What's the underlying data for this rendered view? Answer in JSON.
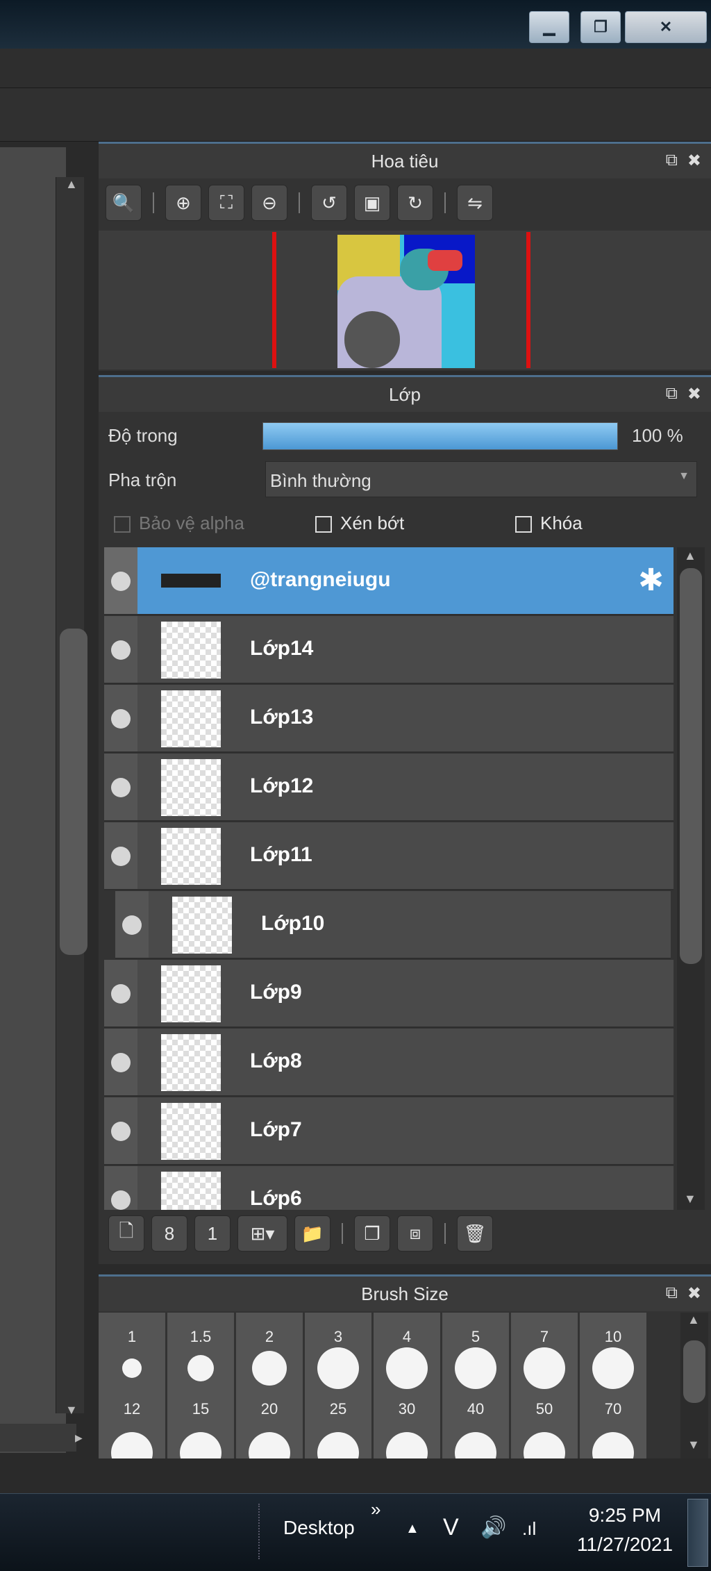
{
  "window": {
    "minimize": "▁",
    "maximize": "❐",
    "close": "✕"
  },
  "navigator": {
    "title": "Hoa tiêu",
    "tools": [
      "zoom-reset-icon",
      "zoom-in-icon",
      "fit-icon",
      "zoom-out-icon",
      "rotate-left-icon",
      "fit-screen-icon",
      "rotate-right-icon",
      "flip-icon"
    ]
  },
  "layers_panel": {
    "title": "Lớp",
    "opacity_label": "Độ trong",
    "opacity_value": "100 %",
    "opacity_fraction": 1.0,
    "blend_label": "Pha trộn",
    "blend_value": "Bình thường",
    "protect_alpha": "Bảo vệ alpha",
    "clipping": "Xén bớt",
    "lock": "Khóa",
    "layers": [
      {
        "name": "@trangneiugu",
        "selected": true
      },
      {
        "name": "Lớp14"
      },
      {
        "name": "Lớp13"
      },
      {
        "name": "Lớp12"
      },
      {
        "name": "Lớp11"
      },
      {
        "name": "Lớp10",
        "indent": true
      },
      {
        "name": "Lớp9"
      },
      {
        "name": "Lớp8"
      },
      {
        "name": "Lớp7"
      },
      {
        "name": "Lớp6"
      }
    ]
  },
  "brush_size": {
    "title": "Brush Size",
    "row1": [
      "1",
      "1.5",
      "2",
      "3",
      "4",
      "5",
      "7",
      "10"
    ],
    "row2": [
      "12",
      "15",
      "20",
      "25",
      "30",
      "40",
      "50",
      "70"
    ]
  },
  "taskbar": {
    "desktop": "Desktop",
    "chevron": "»",
    "time": "9:25 PM",
    "date": "11/27/2021"
  }
}
